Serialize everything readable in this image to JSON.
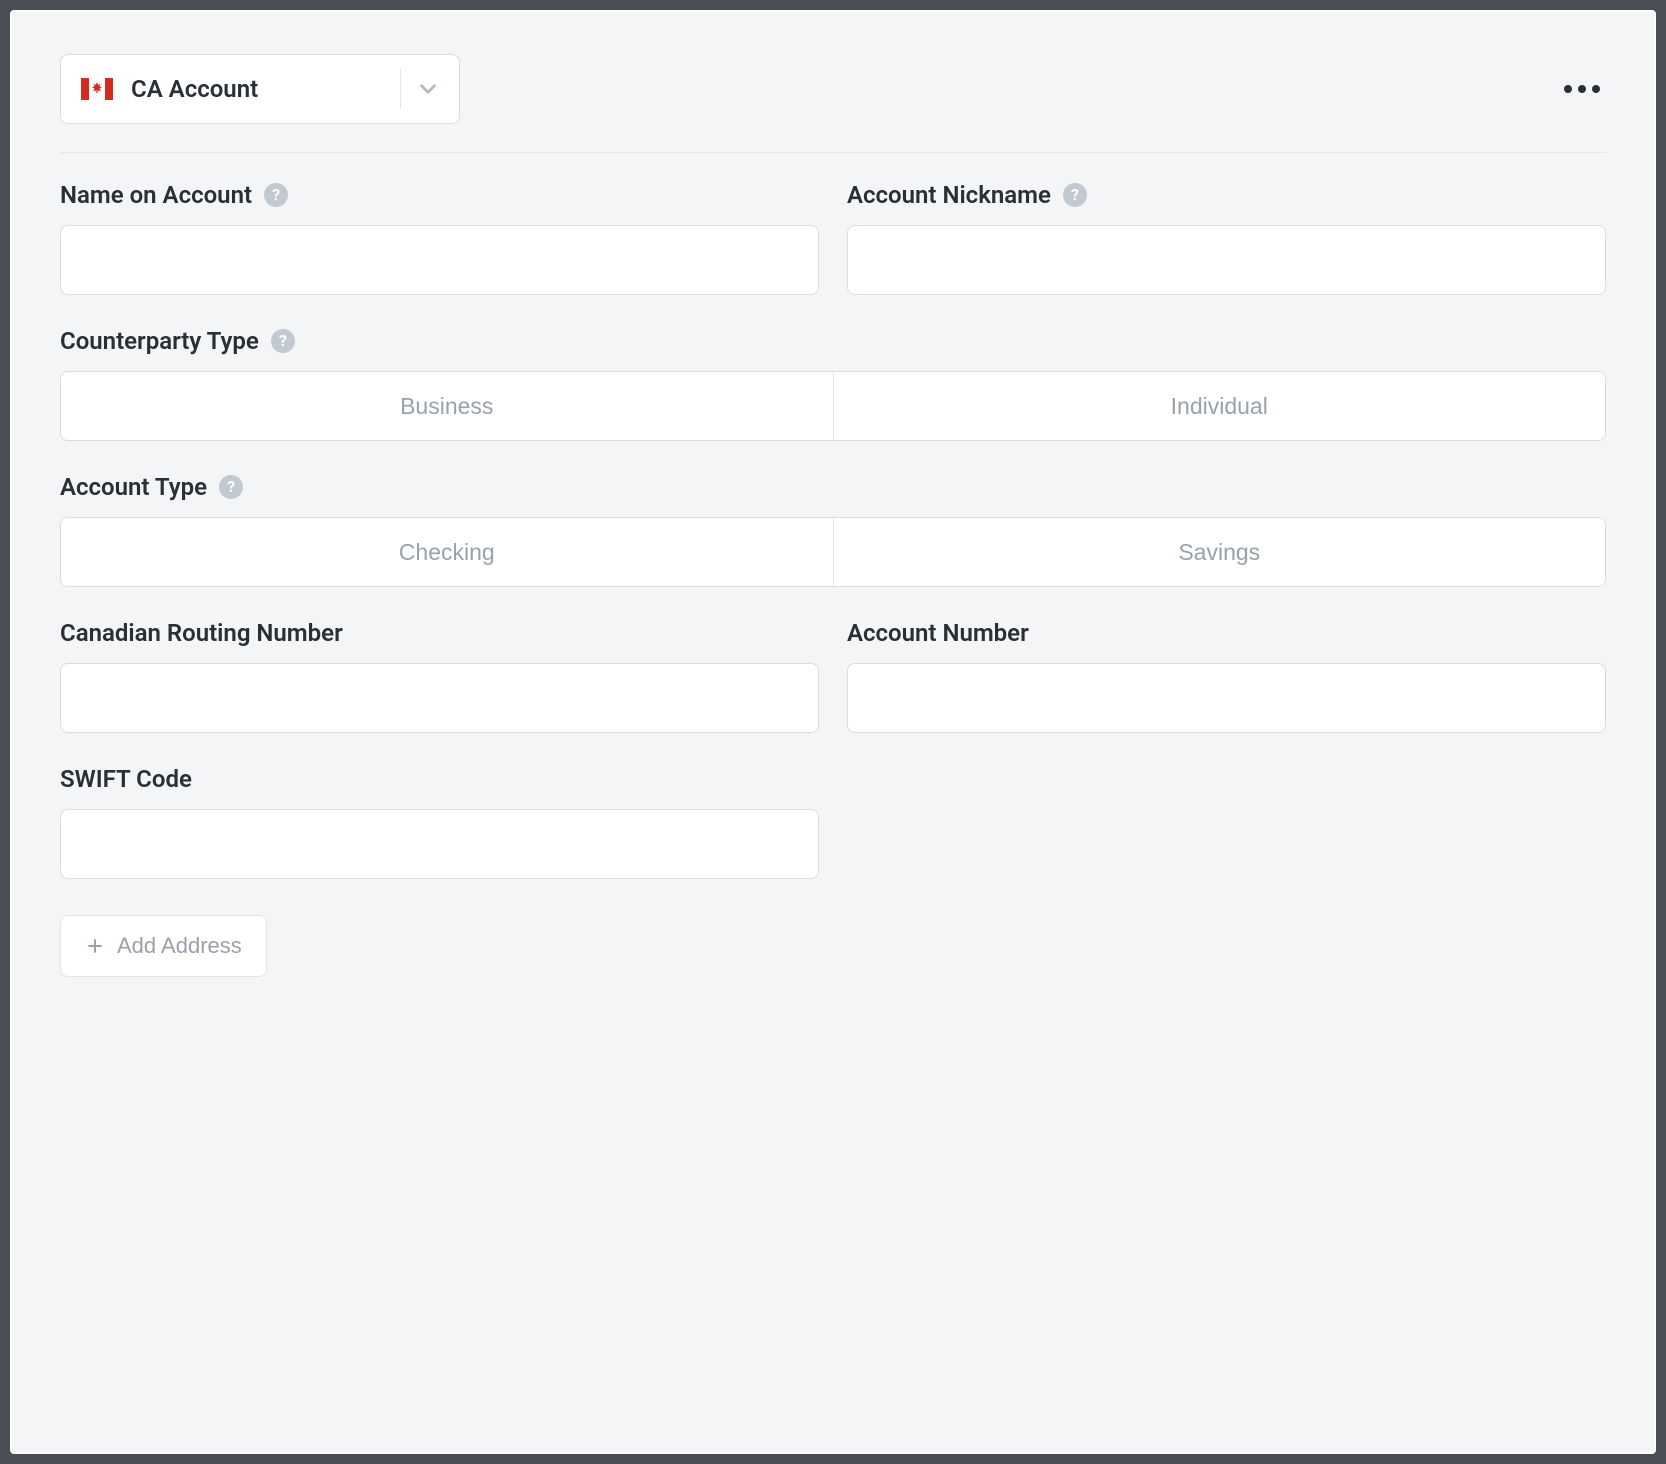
{
  "account_select": {
    "label": "CA Account",
    "flag": "canada"
  },
  "fields": {
    "name_on_account": {
      "label": "Name on Account",
      "value": "",
      "help": true
    },
    "account_nickname": {
      "label": "Account Nickname",
      "value": "",
      "help": true
    },
    "counterparty_type": {
      "label": "Counterparty Type",
      "help": true,
      "options": [
        "Business",
        "Individual"
      ]
    },
    "account_type": {
      "label": "Account Type",
      "help": true,
      "options": [
        "Checking",
        "Savings"
      ]
    },
    "routing_number": {
      "label": "Canadian Routing Number",
      "value": ""
    },
    "account_number": {
      "label": "Account Number",
      "value": ""
    },
    "swift_code": {
      "label": "SWIFT Code",
      "value": ""
    }
  },
  "add_address_label": "Add Address",
  "help_glyph": "?"
}
